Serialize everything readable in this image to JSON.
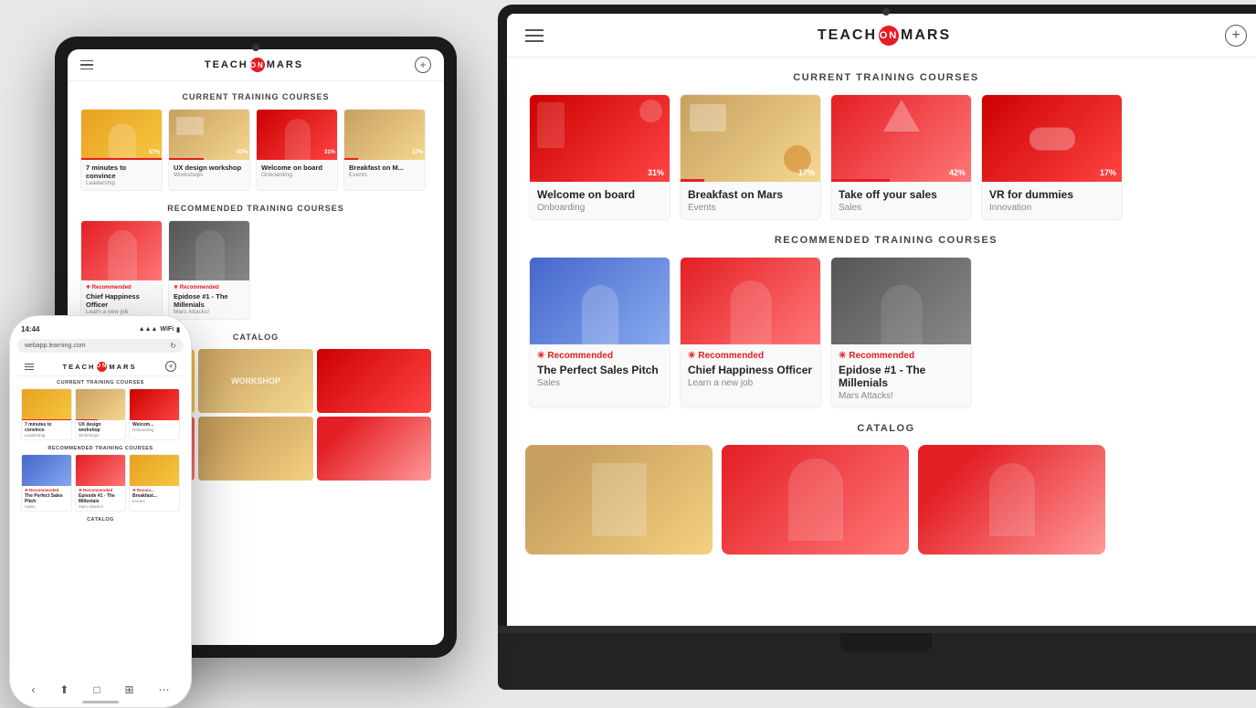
{
  "app": {
    "title_part1": "TEACH",
    "title_on": "ON",
    "title_part2": "MARS",
    "hamburger_label": "menu",
    "plus_label": "add"
  },
  "current_training": {
    "section_title": "CURRENT TRAINING COURSES",
    "courses": [
      {
        "title": "7 minutes to convince",
        "category": "Leadership",
        "progress": 57,
        "img_class": "c-warm"
      },
      {
        "title": "UX design workshop",
        "category": "Workshops",
        "progress": 42,
        "img_class": "c-desk"
      },
      {
        "title": "Welcome on board",
        "category": "Onboarding",
        "progress": 31,
        "img_class": "c-red"
      },
      {
        "title": "Breakfast on Mars",
        "category": "Events",
        "progress": 17,
        "img_class": "c-desk"
      },
      {
        "title": "Take off your sales",
        "category": "Sales",
        "progress": 42,
        "img_class": "c-red2"
      },
      {
        "title": "VR for dummies",
        "category": "Innovation",
        "progress": 17,
        "img_class": "c-red"
      }
    ]
  },
  "recommended_training": {
    "section_title": "RECOMMENDED TRAINING COURSES",
    "courses": [
      {
        "title": "The Perfect Sales Pitch",
        "category": "Sales",
        "badge": "Recommended",
        "img_class": "c-blue"
      },
      {
        "title": "Chief Happiness Officer",
        "category": "Learn a new job",
        "badge": "Recommended",
        "img_class": "c-red2"
      },
      {
        "title": "Epidose #1 - The Millenials",
        "category": "Mars Attacks!",
        "badge": "Recommended",
        "img_class": "c-dark"
      }
    ]
  },
  "catalog": {
    "section_title": "CATALOG",
    "items": [
      {
        "img_class": "c-catalog1"
      },
      {
        "img_class": "c-red2"
      },
      {
        "img_class": "c-warm"
      },
      {
        "img_class": "c-red"
      },
      {
        "img_class": "c-desk"
      },
      {
        "img_class": "c-catalog2"
      }
    ]
  },
  "phone": {
    "time": "14:44",
    "url": "webapp.learning.com",
    "signal": "▲▲▲",
    "wifi": "WiFi",
    "battery": "100%"
  }
}
